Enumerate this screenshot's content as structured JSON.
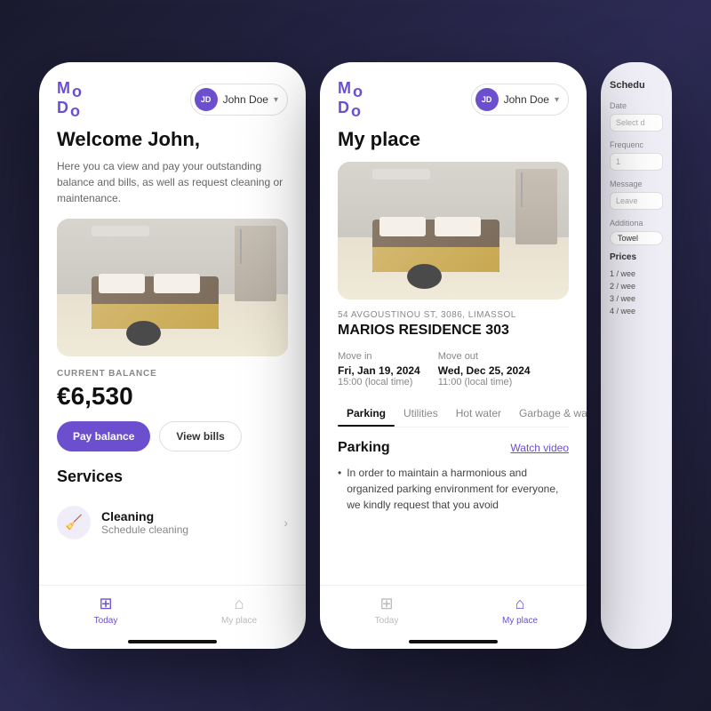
{
  "app": {
    "logo_top": "Mo",
    "logo_bottom": "Do",
    "user_initials": "JD",
    "user_name": "John Doe"
  },
  "phone1": {
    "header": {
      "user_initials": "JD",
      "user_name": "John Doe"
    },
    "welcome": {
      "title": "Welcome John,",
      "description": "Here you ca view and pay your outstanding balance and bills, as well as request cleaning or maintenance."
    },
    "balance": {
      "label": "CURRENT BALANCE",
      "amount": "€6,530"
    },
    "buttons": {
      "pay": "Pay balance",
      "view": "View bills"
    },
    "services": {
      "title": "Services",
      "items": [
        {
          "name": "Cleaning",
          "sub": "Schedule cleaning"
        }
      ]
    },
    "nav": {
      "items": [
        {
          "label": "Today",
          "active": true
        },
        {
          "label": "My place",
          "active": false
        }
      ]
    }
  },
  "phone2": {
    "header": {
      "user_initials": "JD",
      "user_name": "John Doe"
    },
    "title": "My place",
    "address": "54 AVGOUSTINOU ST, 3086, LIMASSOL",
    "property_name": "MARIOS RESIDENCE 303",
    "move_in": {
      "label": "Move in",
      "date": "Fri, Jan 19, 2024",
      "time": "15:00 (local time)"
    },
    "move_out": {
      "label": "Move out",
      "date": "Wed, Dec 25, 2024",
      "time": "11:00 (local time)"
    },
    "tabs": [
      "Parking",
      "Utilities",
      "Hot water",
      "Garbage & wast"
    ],
    "active_tab": "Parking",
    "parking": {
      "title": "Parking",
      "watch_video": "Watch video",
      "description": "In order to maintain a harmonious and organized parking environment for everyone, we kindly request that you avoid"
    },
    "nav": {
      "items": [
        {
          "label": "Today",
          "active": false
        },
        {
          "label": "My place",
          "active": true
        }
      ]
    }
  },
  "phone3": {
    "title": "Schedu",
    "fields": [
      {
        "label": "Date",
        "value": "Select d"
      },
      {
        "label": "Frequenc",
        "value": "1"
      },
      {
        "label": "Message",
        "value": "Leave"
      }
    ],
    "additional_label": "Additiona",
    "towel_tag": "Towel",
    "prices_title": "Prices",
    "price_items": [
      "1 / wee",
      "2 / wee",
      "3 / wee",
      "4 / wee"
    ]
  }
}
